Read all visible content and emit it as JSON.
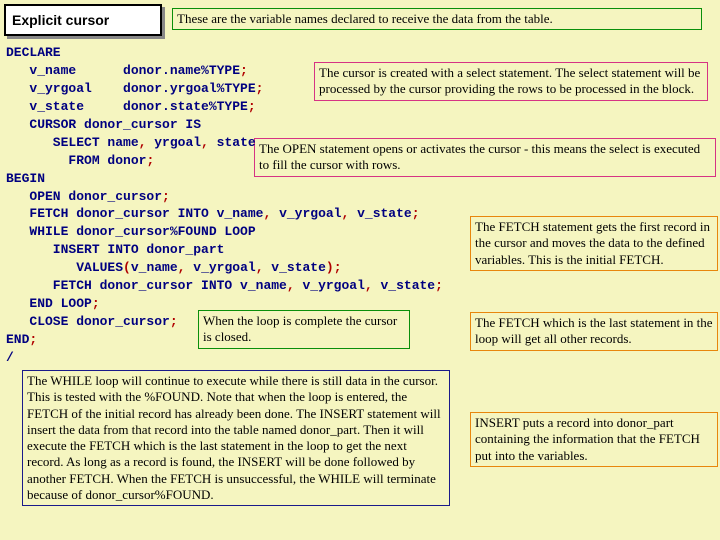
{
  "title": "Explicit cursor",
  "annotations": {
    "top": "These are the variable names declared to receive the data from the table.",
    "cursor_created": "The cursor is created with a select statement. The select statement will be processed by the cursor providing the rows to be processed in the block.",
    "open_stmt": "The OPEN statement opens or activates the cursor - this means the select is executed to fill the cursor with rows.",
    "fetch_first": "The FETCH statement gets the first record in the cursor and moves the data to the defined variables. This is the initial FETCH.",
    "close_stmt": "When the loop is complete the cursor is closed.",
    "fetch_last": "The FETCH which is the last statement in the loop will get all other records.",
    "while_loop": "The WHILE loop will continue to execute while there is still data in the cursor. This is tested with the %FOUND. Note that when the loop is entered, the FETCH of the initial record has already been done. The INSERT statement will insert the data from that record into the table named donor_part. Then it will execute the FETCH which is the last statement in the loop to get the next record. As long as a record is found, the INSERT will be done followed by another FETCH. When the FETCH is unsuccessful, the WHILE will terminate because of donor_cursor%FOUND.",
    "insert_stmt": "INSERT puts a record into donor_part containing the information that the FETCH put into the variables."
  },
  "code": {
    "l1": "DECLARE",
    "l2a": "   v_name      donor.name%TYPE",
    "l2b": ";",
    "l3a": "   v_yrgoal    donor.yrgoal%TYPE",
    "l3b": ";",
    "l4a": "   v_state     donor.state%TYPE",
    "l4b": ";",
    "l5": "   CURSOR donor_cursor IS",
    "l6a": "      SELECT name",
    "l6b": ",",
    "l6c": " yrgoal",
    "l6d": ",",
    "l6e": " state",
    "l7a": "        FROM donor",
    "l7b": ";",
    "l8": "BEGIN",
    "l9a": "   OPEN donor_cursor",
    "l9b": ";",
    "l10a": "   FETCH donor_cursor INTO v_name",
    "l10b": ",",
    "l10c": " v_yrgoal",
    "l10d": ",",
    "l10e": " v_state",
    "l10f": ";",
    "l11": "   WHILE donor_cursor%FOUND LOOP",
    "l12": "      INSERT INTO donor_part",
    "l13a": "         VALUES",
    "l13b": "(",
    "l13c": "v_name",
    "l13d": ",",
    "l13e": " v_yrgoal",
    "l13f": ",",
    "l13g": " v_state",
    "l13h": ");",
    "l14a": "      FETCH donor_cursor INTO v_name",
    "l14b": ",",
    "l14c": " v_yrgoal",
    "l14d": ",",
    "l14e": " v_state",
    "l14f": ";",
    "l15a": "   END LOOP",
    "l15b": ";",
    "l16a": "   CLOSE donor_cursor",
    "l16b": ";",
    "l17a": "END",
    "l17b": ";",
    "l18": "/"
  }
}
